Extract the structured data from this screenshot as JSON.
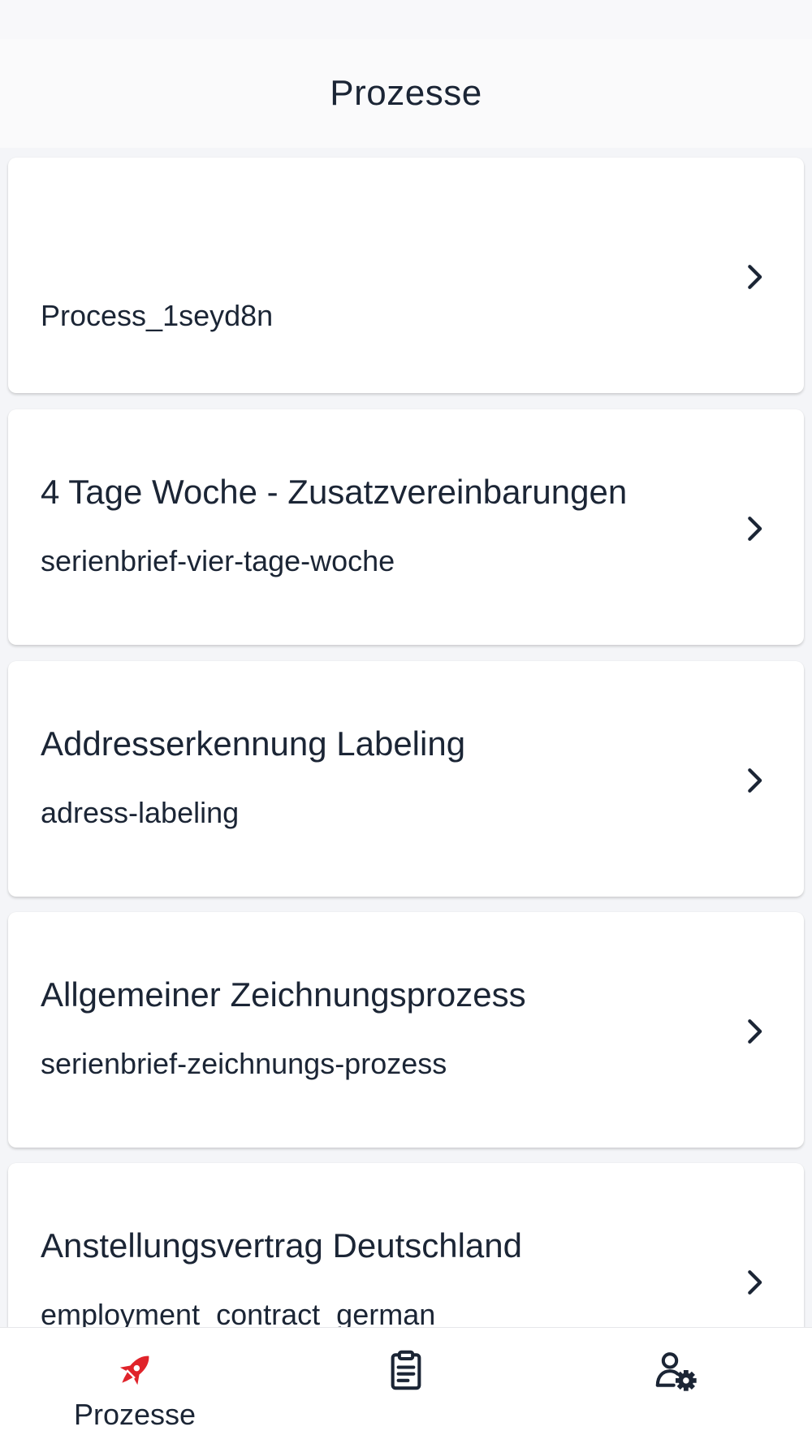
{
  "header": {
    "title": "Prozesse"
  },
  "processes": [
    {
      "name": "",
      "key": "Process_1seyd8n"
    },
    {
      "name": "4 Tage Woche - Zusatzvereinbarungen",
      "key": "serienbrief-vier-tage-woche"
    },
    {
      "name": "Addresserkennung Labeling",
      "key": "adress-labeling"
    },
    {
      "name": "Allgemeiner Zeichnungsprozess",
      "key": "serienbrief-zeichnungs-prozess"
    },
    {
      "name": "Anstellungsvertrag Deutschland",
      "key": "employment_contract_german"
    }
  ],
  "tabbar": {
    "tabs": [
      {
        "label": "Prozesse",
        "icon": "rocket-icon",
        "active": true
      },
      {
        "label": "",
        "icon": "clipboard-icon",
        "active": false
      },
      {
        "label": "",
        "icon": "user-settings-icon",
        "active": false
      }
    ],
    "active_color": "#e0232a",
    "inactive_color": "#1b2535"
  }
}
